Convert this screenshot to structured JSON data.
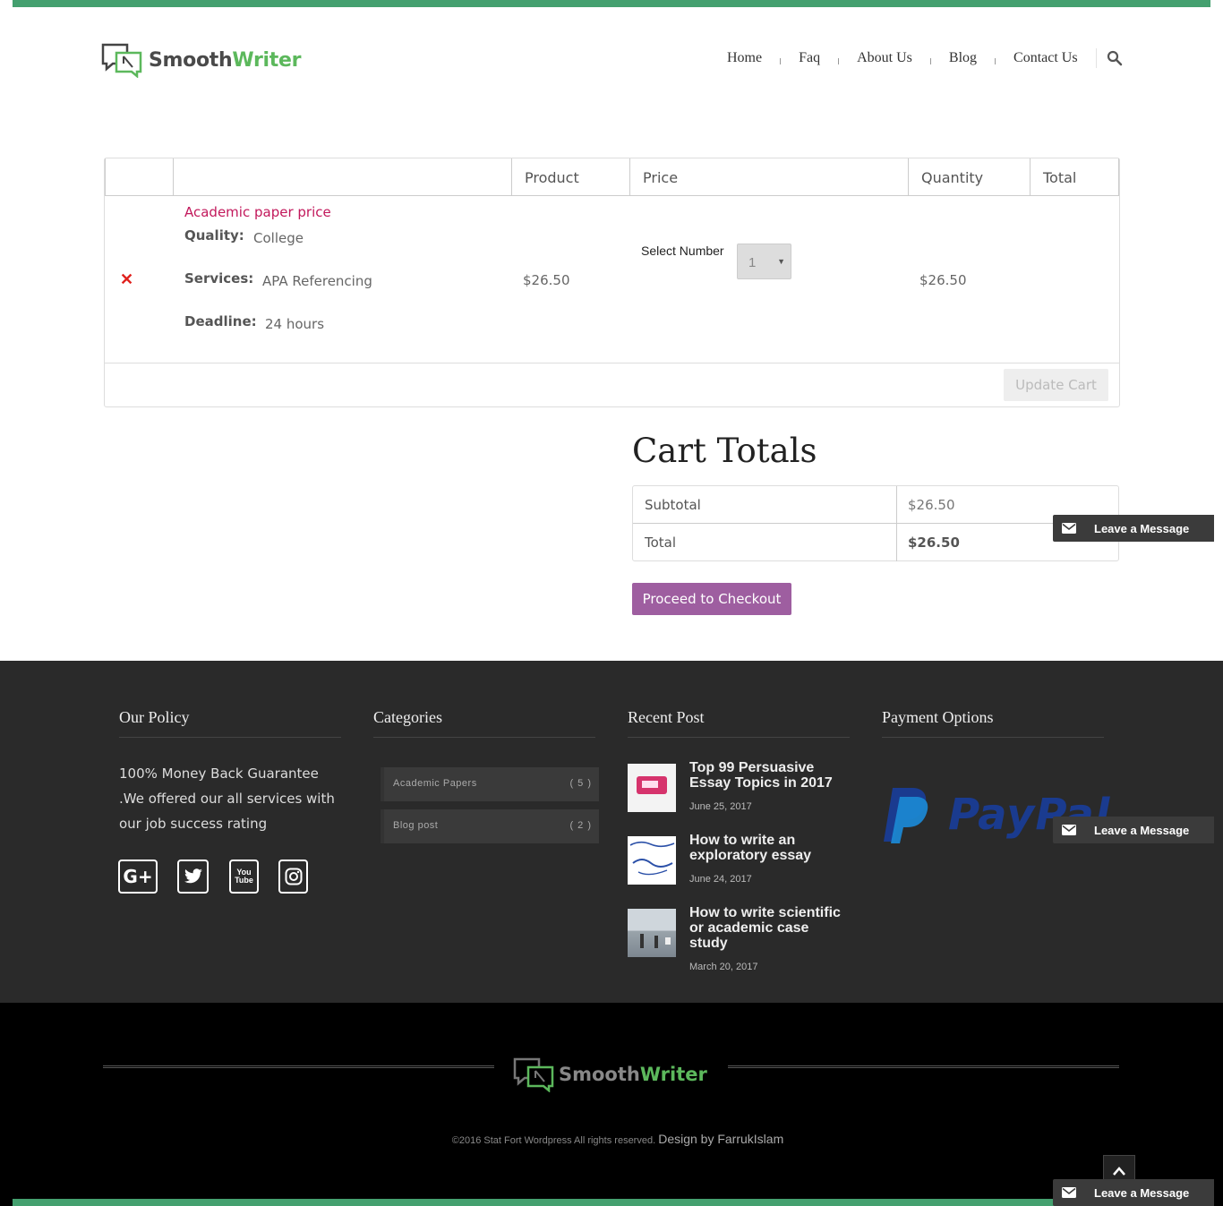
{
  "brand": {
    "name_part1": "Smooth",
    "name_part2": "Writer"
  },
  "nav": {
    "items": [
      "Home",
      "Faq",
      "About Us",
      "Blog",
      "Contact Us"
    ]
  },
  "cart": {
    "headers": {
      "product": "Product",
      "price": "Price",
      "quantity": "Quantity",
      "total": "Total"
    },
    "item": {
      "name": "Academic paper price",
      "quality_label": "Quality:",
      "quality_value": "College",
      "services_label": "Services:",
      "services_value": "APA Referencing",
      "deadline_label": "Deadline:",
      "deadline_value": "24 hours",
      "price": "$26.50",
      "select_label": "Select Number",
      "quantity": "1",
      "total": "$26.50"
    },
    "update_label": "Update Cart"
  },
  "totals": {
    "title": "Cart Totals",
    "subtotal_label": "Subtotal",
    "subtotal_value": "$26.50",
    "total_label": "Total",
    "total_value": "$26.50",
    "checkout_label": "Proceed to Checkout"
  },
  "footer": {
    "policy": {
      "title": "Our Policy",
      "text": "100% Money Back Guarantee .We offered our all services with our job success rating"
    },
    "categories": {
      "title": "Categories",
      "items": [
        {
          "name": "Academic Papers",
          "count": "( 5 )"
        },
        {
          "name": "Blog post",
          "count": "( 2 )"
        }
      ]
    },
    "recent": {
      "title": "Recent Post",
      "posts": [
        {
          "title": "Top 99 Persuasive Essay Topics in 2017",
          "date": "June 25, 2017"
        },
        {
          "title": "How to write an exploratory essay",
          "date": "June 24, 2017"
        },
        {
          "title": "How to write scientific or academic case study",
          "date": "March 20, 2017"
        }
      ]
    },
    "payment": {
      "title": "Payment Options",
      "logo_text": "PayPal"
    }
  },
  "bottom": {
    "copyright": "©2016 Stat Fort Wordpress All rights reserved.",
    "design": "Design by FarrukIslam"
  },
  "chat": {
    "label": "Leave a Message"
  },
  "colors": {
    "accent": "#44a06f",
    "brand_green": "#5cb85c",
    "checkout": "#9e5ea0",
    "product_link": "#c2185b",
    "remove": "#e0211d"
  }
}
